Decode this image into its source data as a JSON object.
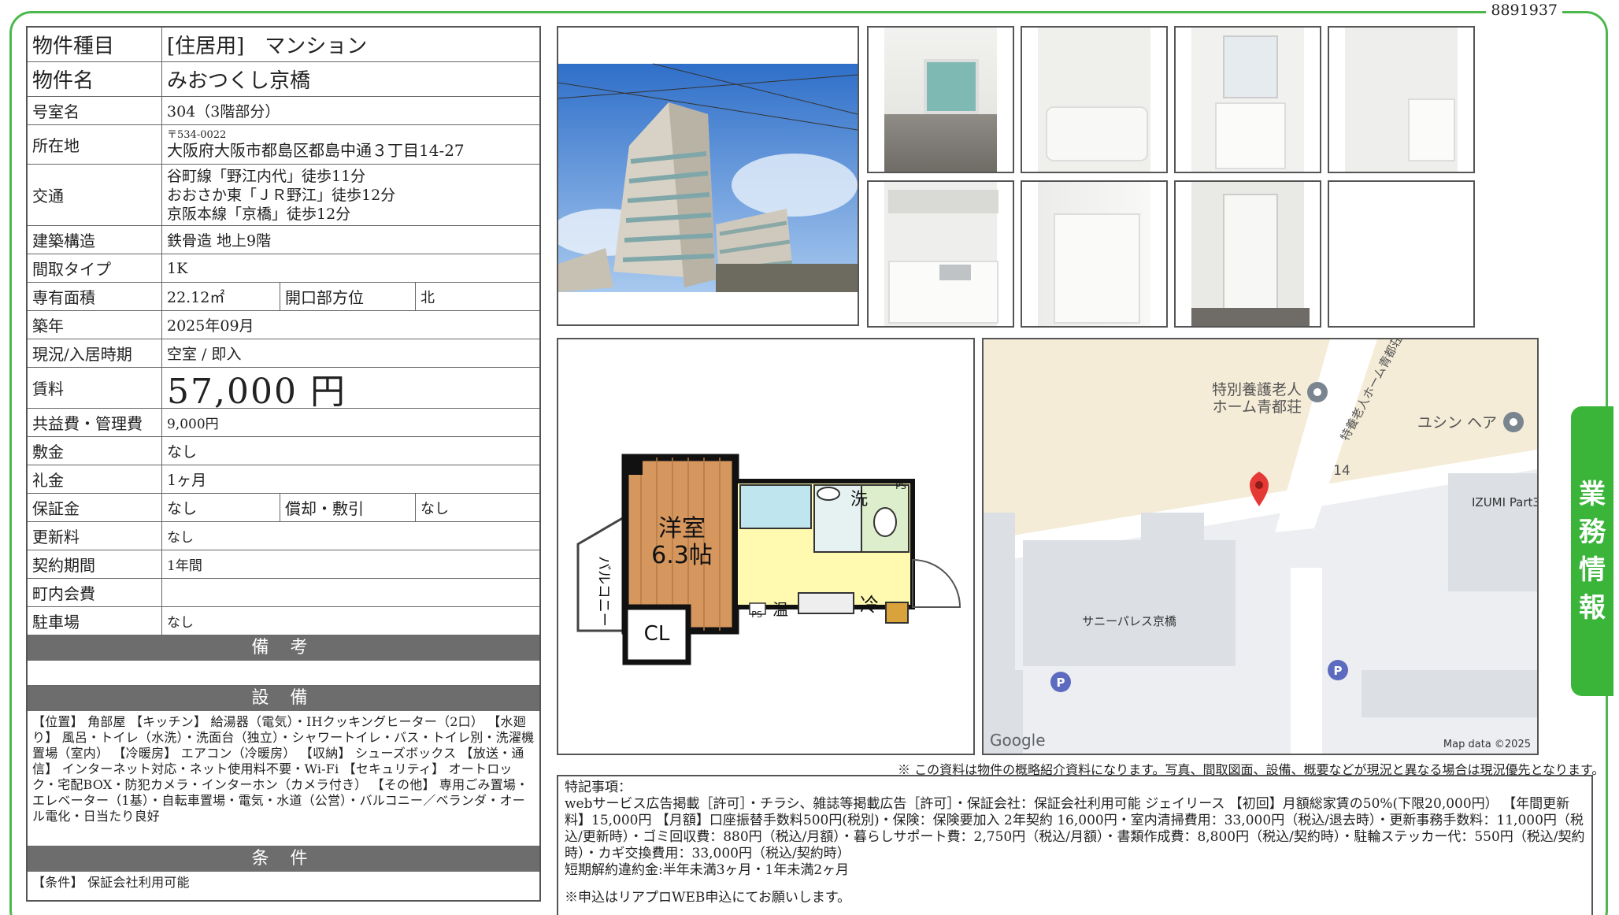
{
  "property_id": "8891937",
  "side_tab": [
    "業",
    "務",
    "情",
    "報"
  ],
  "spec": {
    "type_label": "物件種目",
    "type_value": "[住居用]　マンション",
    "name_label": "物件名",
    "name_value": "みおつくし京橋",
    "room_label": "号室名",
    "room_value": "304（3階部分）",
    "address_label": "所在地",
    "postal": "〒534-0022",
    "address": "大阪府大阪市都島区都島中通３丁目14-27",
    "transport_label": "交通",
    "transport": [
      "谷町線「野江内代」徒歩11分",
      "おおさか東「ＪＲ野江」徒歩12分",
      "京阪本線「京橋」徒歩12分"
    ],
    "structure_label": "建築構造",
    "structure_value": "鉄骨造 地上9階",
    "layout_label": "間取タイプ",
    "layout_value": "1K",
    "area_label": "専有面積",
    "area_value": "22.12㎡",
    "direction_label": "開口部方位",
    "direction_value": "北",
    "built_label": "築年",
    "built_value": "2025年09月",
    "status_label": "現況/入居時期",
    "status_value": "空室 / 即入",
    "rent_label": "賃料",
    "rent_value": "57,000 円",
    "fee_label": "共益費・管理費",
    "fee_value": "9,000円",
    "deposit_label": "敷金",
    "deposit_value": "なし",
    "key_money_label": "礼金",
    "key_money_value": "1ヶ月",
    "guarantee_label": "保証金",
    "guarantee_value": "なし",
    "amort_label": "償却・敷引",
    "amort_value": "なし",
    "renewal_label": "更新料",
    "renewal_value": "なし",
    "contract_label": "契約期間",
    "contract_value": "1年間",
    "association_label": "町内会費",
    "association_value": "",
    "parking_label": "駐車場",
    "parking_value": "なし",
    "remarks_bar": "備 考",
    "equipment_bar": "設 備",
    "equipment_text": "【位置】 角部屋 【キッチン】 給湯器（電気）・IHクッキングヒーター（2口） 【水廻り】 風呂・トイレ（水洗）・洗面台（独立）・シャワートイレ・バス・トイレ別・洗濯機置場（室内） 【冷暖房】 エアコン（冷暖房） 【収納】 シューズボックス 【放送・通信】 インターネット対応・ネット使用料不要・Wi-Fi 【セキュリティ】 オートロック・宅配BOX・防犯カメラ・インターホン（カメラ付き） 【その他】 専用ごみ置場・エレベーター（1基）・自転車置場・電気・水道（公営）・バルコニー／ベランダ・オール電化・日当たり良好",
    "conditions_bar": "条 件",
    "conditions_text": "【条件】 保証会社利用可能"
  },
  "floorplan": {
    "room_name": "洋室",
    "room_size": "6.3帖",
    "closet": "CL",
    "balcony": "バルコニー",
    "wash": "洗",
    "fridge": "冷",
    "heater": "温",
    "ps1": "PS",
    "ps2": "PS"
  },
  "map": {
    "label_facility": "特別養護老人\nホーム青都荘",
    "label_facility_line1": "特別養護老人",
    "label_facility_line2": "ホーム青都荘",
    "label_road": "特養老人ホーム青都荘",
    "label_salon": "ユシン ヘア",
    "label_block": "14",
    "label_izumi": "IZUMI Part3",
    "label_building": "サニーパレス京橋",
    "parking_symbol": "P",
    "google": "Google",
    "map_data": "Map data ©2025"
  },
  "disclaimer": "※ この資料は物件の概略紹介資料になります。写真、間取図面、設備、概要などが現況と異なる場合は現況優先となります。",
  "remarks": {
    "heading": "特記事項：",
    "body": "webサービス広告掲載［許可］・チラシ、雑誌等掲載広告［許可］・保証会社：保証会社利用可能 ジェイリース 【初回】月額総家賃の50%(下限20,000円） 【年間更新料】15,000円 【月額】口座振替手数料500円(税別)・保険：保険要加入 2年契約 16,000円・室内清掃費用：33,000円（税込/退去時）・更新事務手数料：11,000円（税込/更新時）・ゴミ回収費：880円（税込/月額）・暮らしサポート費：2,750円（税込/月額）・書類作成費：8,800円（税込/契約時）・駐輪ステッカー代：550円（税込/契約時）・カギ交換費用：33,000円（税込/契約時）",
    "short_term": "短期解約違約金:半年未満3ヶ月・1年未満2ヶ月",
    "apply": "※申込はリアプロWEB申込にてお願いします。"
  }
}
